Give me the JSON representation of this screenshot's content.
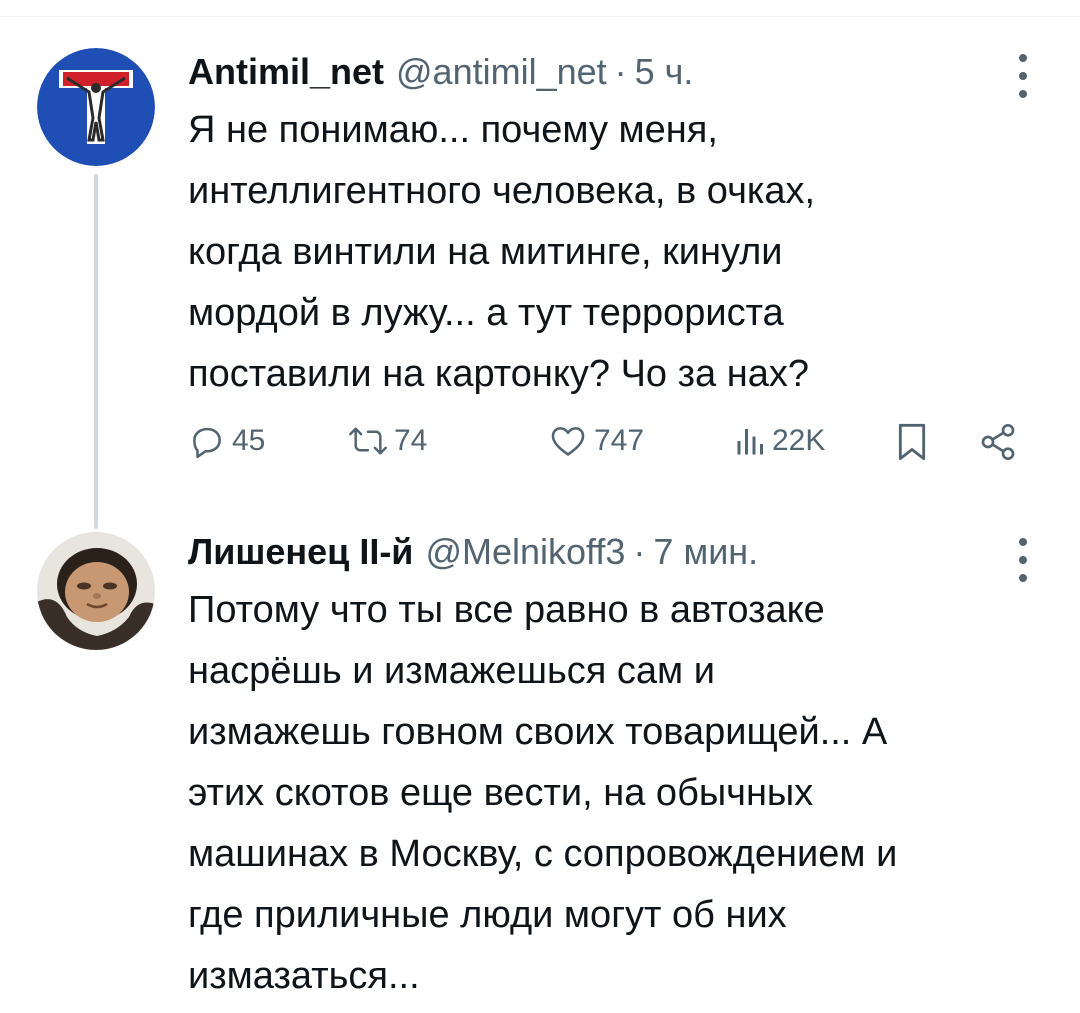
{
  "tweets": [
    {
      "display_name": "Antimil_net",
      "handle": "@antimil_net",
      "separator": "·",
      "time": "5 ч.",
      "text": "Я не понимаю... почему меня,\nинтеллигентного человека, в очках,\nкогда винтили на митинге, кинули\nмордой в лужу... а тут террориста\nпоставили на картонку? Чо за нах?",
      "avatar_icon": "dead-end-road-sign-icon",
      "actions": {
        "replies": "45",
        "reposts": "74",
        "likes": "747",
        "views": "22K"
      }
    },
    {
      "display_name": "Лишенец II-й",
      "handle": "@Melnikoff3",
      "separator": "·",
      "time": "7 мин.",
      "text": "Потому что ты все равно в автозаке\nнасрёшь и измажешься сам и\nизмажешь говном своих товарищей... А\nэтих скотов еще вести, на обычных\nмашинах в Москву, с сопровождением и\nгде приличные люди могут об них\nизмазаться...",
      "avatar_icon": "user-photo-avatar"
    }
  ],
  "colors": {
    "text": "#0f1419",
    "secondary": "#536471",
    "thread_line": "#cfd9de"
  }
}
